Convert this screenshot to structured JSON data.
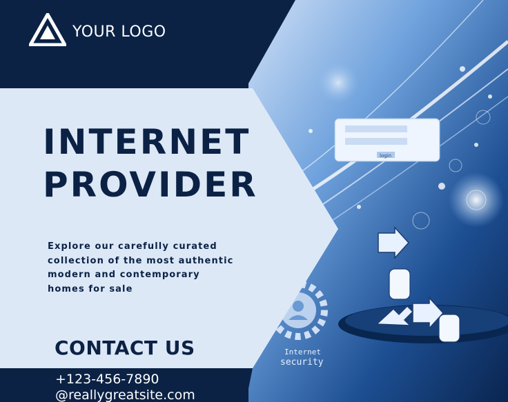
{
  "logo": {
    "text": "YOUR LOGO"
  },
  "headline": {
    "line1": "INTERNET",
    "line2": "PROVIDER"
  },
  "description": {
    "lines": [
      "Explore our carefully curated",
      "collection of the most authentic",
      "modern and contemporary",
      "homes for sale"
    ]
  },
  "contact": {
    "heading": "CONTACT US",
    "phone": "+123-456-7890",
    "website": "@reallygreatsite.com"
  },
  "image": {
    "login_label": "login",
    "caption_line1": "Internet",
    "caption_line2": "security"
  },
  "colors": {
    "navy": "#0b2245",
    "light_panel": "#dde8f7",
    "white": "#ffffff",
    "glow_blue": "#4e8fd8"
  }
}
